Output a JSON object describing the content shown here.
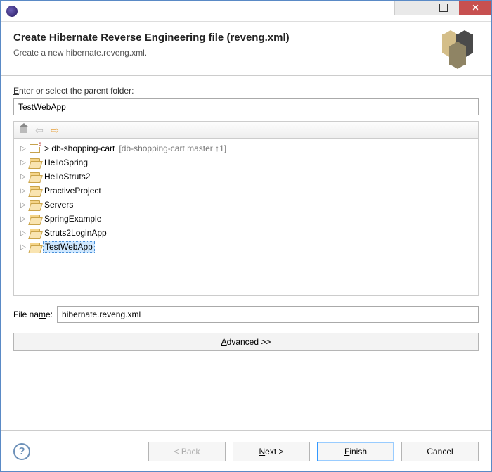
{
  "header": {
    "title": "Create Hibernate Reverse Engineering file (reveng.xml)",
    "subtitle": "Create a new hibernate.reveng.xml."
  },
  "labels": {
    "parent_folder_en": "E",
    "parent_folder_rest": "nter or select the parent folder:",
    "filename_char": "m",
    "filename_before": "File na",
    "filename_after": "e:",
    "advanced_char": "A",
    "advanced_rest": "dvanced >>"
  },
  "fields": {
    "parent_folder_value": "TestWebApp",
    "filename_value": "hibernate.reveng.xml"
  },
  "tree": [
    {
      "label": "> db-shopping-cart",
      "suffix": "  [db-shopping-cart master ↑1]",
      "icon": "repo",
      "selected": false
    },
    {
      "label": "HelloSpring",
      "icon": "folder-open",
      "selected": false
    },
    {
      "label": "HelloStruts2",
      "icon": "folder-open",
      "selected": false
    },
    {
      "label": "PractiveProject",
      "icon": "folder-open",
      "selected": false
    },
    {
      "label": "Servers",
      "icon": "folder-open",
      "selected": false
    },
    {
      "label": "SpringExample",
      "icon": "folder-open",
      "selected": false
    },
    {
      "label": "Struts2LoginApp",
      "icon": "folder-open",
      "selected": false
    },
    {
      "label": "TestWebApp",
      "icon": "folder-open",
      "selected": true
    }
  ],
  "buttons": {
    "back": "< Back",
    "next_char": "N",
    "next_rest": "ext >",
    "finish_char": "F",
    "finish_rest": "inish",
    "cancel": "Cancel"
  }
}
